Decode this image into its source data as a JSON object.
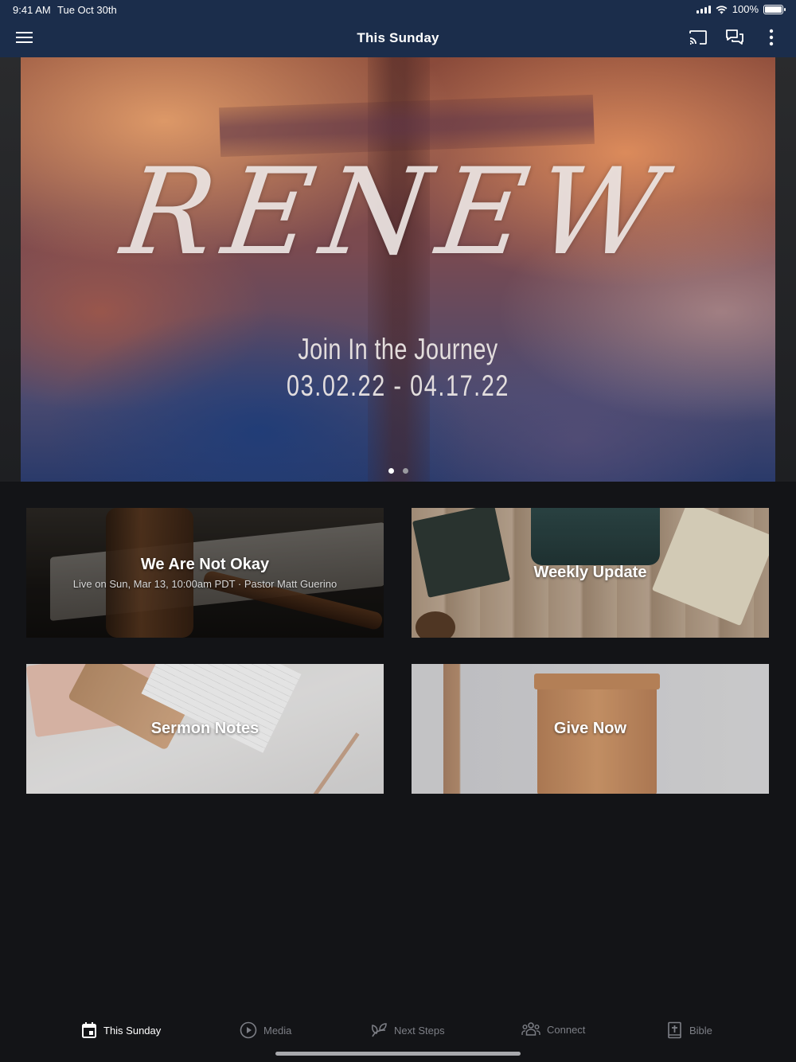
{
  "status_bar": {
    "time": "9:41 AM",
    "date": "Tue Oct 30th",
    "battery": "100%"
  },
  "nav": {
    "title": "This Sunday"
  },
  "hero": {
    "title": "RENEW",
    "subtitle": "Join In the Journey",
    "dates": "03.02.22 - 04.17.22",
    "page_count": 2,
    "active_page": 1
  },
  "cards": [
    {
      "title": "We Are Not Okay",
      "subtitle": "Live on Sun, Mar 13, 10:00am PDT · Pastor Matt Guerino"
    },
    {
      "title": "Weekly Update"
    },
    {
      "title": "Sermon Notes"
    },
    {
      "title": "Give Now"
    }
  ],
  "tabs": [
    {
      "label": "This Sunday",
      "icon": "calendar-icon",
      "active": true
    },
    {
      "label": "Media",
      "icon": "play-circle-icon",
      "active": false
    },
    {
      "label": "Next Steps",
      "icon": "sprout-icon",
      "active": false
    },
    {
      "label": "Connect",
      "icon": "people-icon",
      "active": false
    },
    {
      "label": "Bible",
      "icon": "bible-icon",
      "active": false
    }
  ],
  "colors": {
    "nav_bg": "#1b2d4b",
    "app_bg": "#131417",
    "tab_inactive": "#7d7f86",
    "tab_active": "#ffffff"
  }
}
